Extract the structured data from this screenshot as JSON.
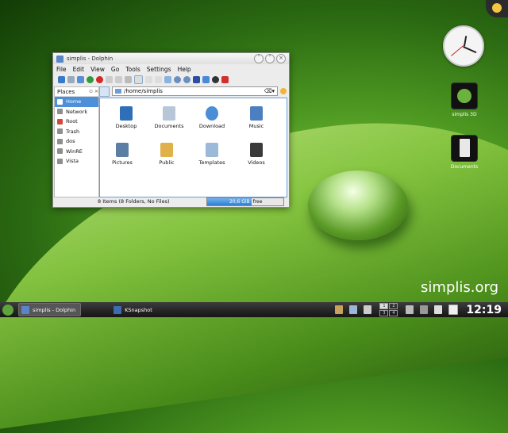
{
  "window": {
    "title": "simplis - Dolphin",
    "menu": [
      "File",
      "Edit",
      "View",
      "Go",
      "Tools",
      "Settings",
      "Help"
    ],
    "places_header": "Places",
    "places": [
      {
        "label": "Home",
        "icon": "home-icon",
        "selected": true
      },
      {
        "label": "Network",
        "icon": "network-icon",
        "selected": false
      },
      {
        "label": "Root",
        "icon": "root-folder-icon",
        "selected": false
      },
      {
        "label": "Trash",
        "icon": "trash-icon",
        "selected": false
      },
      {
        "label": "dos",
        "icon": "drive-icon",
        "selected": false
      },
      {
        "label": "WinRE",
        "icon": "drive-icon",
        "selected": false
      },
      {
        "label": "Vista",
        "icon": "drive-icon",
        "selected": false
      }
    ],
    "location": "/home/simplis",
    "files": [
      {
        "name": "Desktop",
        "icon": "desktop-folder-icon",
        "color": "#2f6fb8"
      },
      {
        "name": "Documents",
        "icon": "documents-folder-icon",
        "color": "#b7c7d8"
      },
      {
        "name": "Download",
        "icon": "download-folder-icon",
        "color": "#4b8ed6"
      },
      {
        "name": "Music",
        "icon": "music-folder-icon",
        "color": "#4b7fc0"
      },
      {
        "name": "Pictures",
        "icon": "pictures-folder-icon",
        "color": "#5c7ea5"
      },
      {
        "name": "Public",
        "icon": "public-folder-icon",
        "color": "#e0b14a"
      },
      {
        "name": "Templates",
        "icon": "templates-folder-icon",
        "color": "#9db9d9"
      },
      {
        "name": "Videos",
        "icon": "videos-folder-icon",
        "color": "#3a3a3a"
      }
    ],
    "status_text": "8 Items (8 Folders, No Files)",
    "free_space": "20,6 GiB",
    "free_label": "free",
    "used_fraction": 0.58
  },
  "desktop": {
    "icons": [
      {
        "label": "simplis 3D",
        "icon": "simplis-3d-icon"
      },
      {
        "label": "Documents",
        "icon": "documents-icon"
      }
    ],
    "brand": "simplis.org"
  },
  "taskbar": {
    "tasks": [
      {
        "label": "simplis - Dolphin",
        "active": true
      },
      {
        "label": "KSnapshot",
        "active": false
      }
    ],
    "pager": [
      "1",
      "2",
      "3",
      "4"
    ],
    "active_desktop": "1",
    "clock": "12:19"
  },
  "colors": {
    "selection": "#4d8fd8",
    "accent_green": "#5ca43b"
  }
}
